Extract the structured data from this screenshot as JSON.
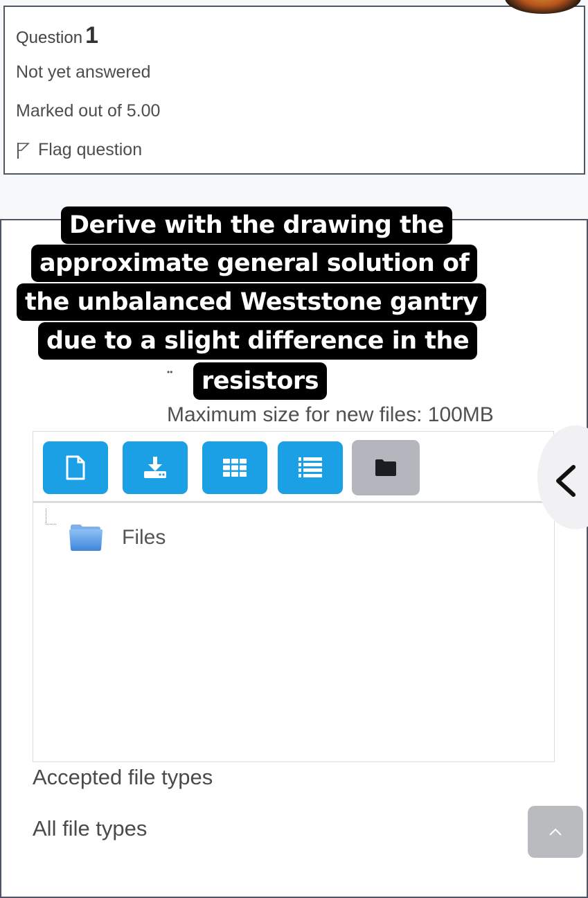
{
  "question_info": {
    "question_label": "Question",
    "question_number": "1",
    "status": "Not yet answered",
    "marks": "Marked out of 5.00",
    "flag_label": "Flag question"
  },
  "overlay_caption": {
    "lines": [
      "Derive with the drawing the",
      "approximate general solution of",
      "the unbalanced Weststone gantry",
      "due to a slight difference in the",
      "resistors"
    ]
  },
  "file_picker": {
    "max_size": "Maximum size for new files: 100MB",
    "toolbar": [
      {
        "icon": "file-icon",
        "label": "Add file"
      },
      {
        "icon": "download-icon",
        "label": "Download all"
      },
      {
        "icon": "grid-icon",
        "label": "Display folder with file icons"
      },
      {
        "icon": "list-icon",
        "label": "Display folder with file details"
      },
      {
        "icon": "folder-icon",
        "label": "Display folder as file tree"
      }
    ],
    "tree_root": {
      "icon": "folder-icon",
      "label": "Files"
    },
    "accepted_label": "Accepted file types",
    "accepted_value": "All file types"
  },
  "colors": {
    "toolbar_button": "#1ba0e6",
    "toolbar_button_active": "#b3b7bd",
    "overlay_bg": "#000000",
    "overlay_text": "#ffffff"
  }
}
